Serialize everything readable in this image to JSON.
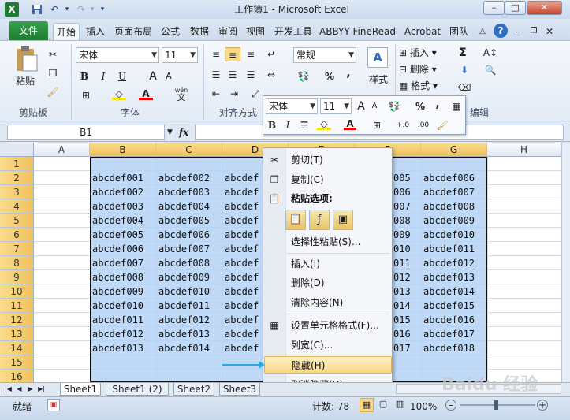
{
  "window": {
    "title": "工作簿1 - Microsoft Excel",
    "min": "–",
    "max": "□",
    "close": "✕"
  },
  "quick_access": {
    "app_icon": "X",
    "save": "save-icon",
    "undo": "undo-icon",
    "redo": "redo-icon",
    "customize": "▾"
  },
  "tabs": [
    "文件",
    "开始",
    "插入",
    "页面布局",
    "公式",
    "数据",
    "审阅",
    "视图",
    "开发工具",
    "ABBYY FineReader",
    "Acrobat",
    "团队"
  ],
  "ribbon": {
    "clipboard": {
      "paste": "粘贴",
      "label": "剪贴板"
    },
    "font": {
      "name": "宋体",
      "size": "11",
      "label": "字体",
      "bold": "B",
      "italic": "I",
      "underline": "U",
      "grow": "A",
      "shrink": "A",
      "wen": "wén",
      "wen_char": "文"
    },
    "alignment": {
      "label": "对齐方式"
    },
    "number": {
      "format": "常规",
      "percent": "%",
      "comma": ","
    },
    "styles": {
      "label": "样式"
    },
    "cells": {
      "insert": "插入",
      "delete": "删除",
      "format": "格式"
    },
    "editing": {
      "sum": "Σ",
      "label": "编辑"
    }
  },
  "formula_bar": {
    "name_box": "B1",
    "fx": "fx",
    "value": ""
  },
  "columns": [
    "A",
    "B",
    "C",
    "D",
    "E",
    "F",
    "G",
    "H"
  ],
  "rows": [
    "1",
    "2",
    "3",
    "4",
    "5",
    "6",
    "7",
    "8",
    "9",
    "10",
    "11",
    "12",
    "13",
    "14",
    "15",
    "16"
  ],
  "cells": {
    "B": [
      "abcdef001",
      "abcdef002",
      "abcdef003",
      "abcdef004",
      "abcdef005",
      "abcdef006",
      "abcdef007",
      "abcdef008",
      "abcdef009",
      "abcdef010",
      "abcdef011",
      "abcdef012",
      "abcdef013"
    ],
    "C": [
      "abcdef002",
      "abcdef003",
      "abcdef004",
      "abcdef005",
      "abcdef006",
      "abcdef007",
      "abcdef008",
      "abcdef009",
      "abcdef010",
      "abcdef011",
      "abcdef012",
      "abcdef013",
      "abcdef014"
    ],
    "D": [
      "abcdef",
      "abcdef",
      "abcdef",
      "abcdef",
      "abcdef",
      "abcdef",
      "abcdef",
      "abcdef",
      "abcdef",
      "abcdef",
      "abcdef",
      "abcdef",
      "abcdef"
    ],
    "F": [
      "005",
      "006",
      "007",
      "008",
      "009",
      "010",
      "011",
      "012",
      "013",
      "014",
      "015",
      "016",
      "017"
    ],
    "G": [
      "abcdef006",
      "abcdef007",
      "abcdef008",
      "abcdef009",
      "abcdef010",
      "abcdef011",
      "abcdef012",
      "abcdef013",
      "abcdef014",
      "abcdef015",
      "abcdef016",
      "abcdef017",
      "abcdef018"
    ]
  },
  "mini_toolbar": {
    "font": "宋体",
    "size": "11",
    "bold": "B",
    "italic": "I",
    "percent": "%",
    "comma": ","
  },
  "context_menu": {
    "items": [
      "剪切(T)",
      "复制(C)",
      "粘贴选项:",
      "选择性粘贴(S)...",
      "插入(I)",
      "删除(D)",
      "清除内容(N)",
      "设置单元格格式(F)...",
      "列宽(C)...",
      "隐藏(H)",
      "取消隐藏(U)"
    ],
    "highlighted": "隐藏(H)"
  },
  "sheets": [
    "Sheet1",
    "Sheet1 (2)",
    "Sheet2",
    "Sheet3"
  ],
  "status": {
    "ready": "就绪",
    "count": "计数: 78",
    "zoom": "100%"
  },
  "watermark": "Baidu 经验",
  "colors": {
    "file_tab": "#1f7a33",
    "selection": "#b4d2f5",
    "highlight": "#f8d884",
    "hint_arrow": "#28a8de"
  }
}
